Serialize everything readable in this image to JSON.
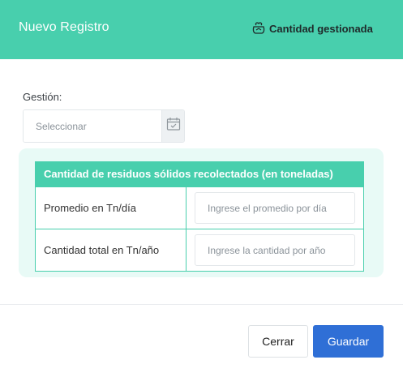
{
  "header": {
    "title": "Nuevo Registro",
    "right_label": "Cantidad gestionada",
    "right_icon": "recycle-bag-icon",
    "color": "#48cfad"
  },
  "form": {
    "gestion_label": "Gestión:",
    "gestion_placeholder": "Seleccionar",
    "calendar_icon": "calendar-icon"
  },
  "table": {
    "title": "Cantidad de residuos sólidos recolectados (en toneladas)",
    "rows": [
      {
        "label": "Promedio en Tn/día",
        "placeholder": "Ingrese el promedio por día"
      },
      {
        "label": "Cantidad total en Tn/año",
        "placeholder": "Ingrese la cantidad por año"
      }
    ]
  },
  "footer": {
    "close_label": "Cerrar",
    "save_label": "Guardar",
    "save_color": "#2f6fd6"
  }
}
